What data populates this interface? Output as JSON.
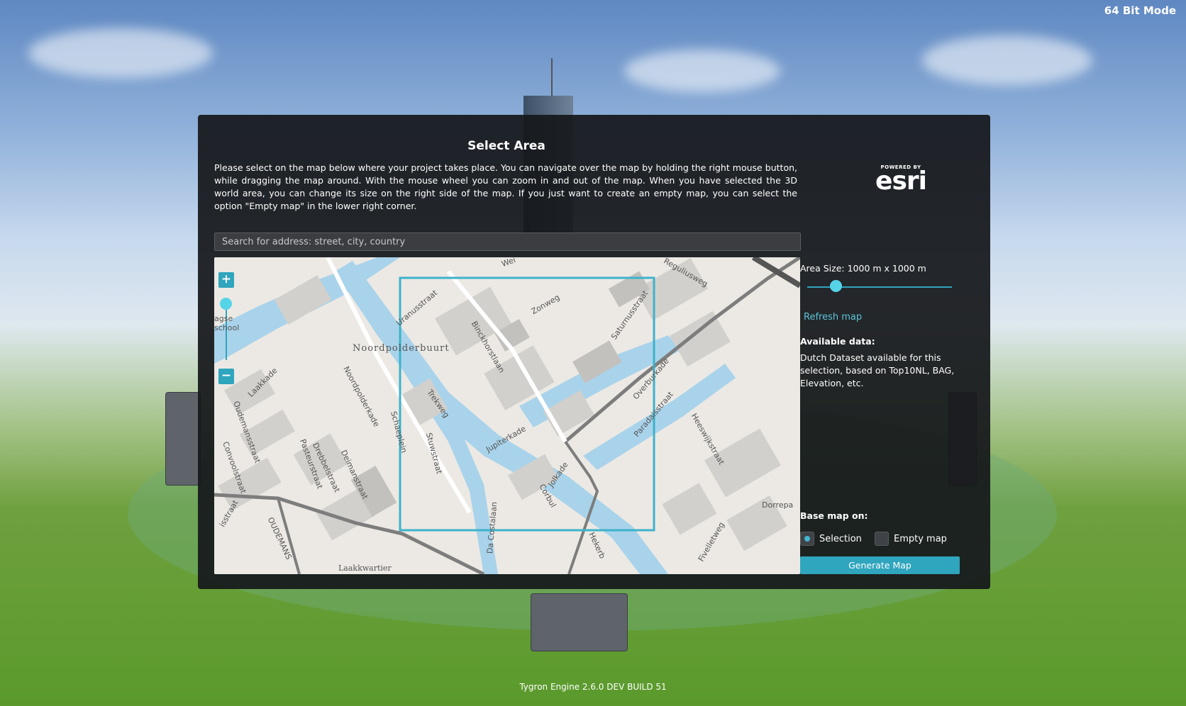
{
  "app": {
    "mode_label": "64 Bit Mode",
    "footer": "Tygron Engine 2.6.0 DEV BUILD 51"
  },
  "dialog": {
    "title": "Select Area",
    "description": "Please select on the map below where your project takes place. You can navigate over the map by holding the right mouse button, while dragging the map around. With the mouse wheel you can zoom in and out of the map. When you have selected the 3D world area, you can change its size on the right side of the map. If you just want to create an empty map, you can select the option \"Empty map\" in the lower right corner.",
    "esri": {
      "powered_by": "POWERED BY",
      "brand": "esri"
    },
    "search": {
      "placeholder": "Search for address: street, city, country",
      "value": ""
    },
    "map": {
      "zoom_in": "+",
      "zoom_out": "−",
      "labels": [
        "agse school",
        "Noordpolderbuurt",
        "Laakkade",
        "Noordpolderkade",
        "Oudemansstraat",
        "Convoolstraat",
        "Pasteurstraat",
        "Drebbelstraat",
        "Deimanstraat",
        "OUDEMANS",
        "Schaeplein",
        "Stuwstraat",
        "Trekweg",
        "Uranusstraat",
        "Binckhorstlaan",
        "Zonweg",
        "Saturnusstraat",
        "Jupiterkade",
        "Overburkade",
        "Paradaisstraat",
        "Heeswijkstraat",
        "Dorrepa",
        "Corbul",
        "Jolkade",
        "Da Costalaan",
        "Laakkwartier",
        "Reguliusweg",
        "Fivelletweg",
        "Hekerb",
        "Wei",
        "isstraat"
      ]
    },
    "area_size": "Area Size: 1000 m x 1000 m",
    "area_slider_fraction": 0.2,
    "refresh_label": "Refresh map",
    "available_heading": "Available data:",
    "available_text": "Dutch Dataset available for this selection, based on Top10NL, BAG, Elevation, etc.",
    "base_heading": "Base map on:",
    "options": [
      {
        "label": "Selection",
        "selected": true
      },
      {
        "label": "Empty map",
        "selected": false
      }
    ],
    "generate_label": "Generate Map"
  },
  "colors": {
    "accent": "#2fa5be",
    "water": "#a9d3ea",
    "dialog_bg": "#16181b"
  }
}
